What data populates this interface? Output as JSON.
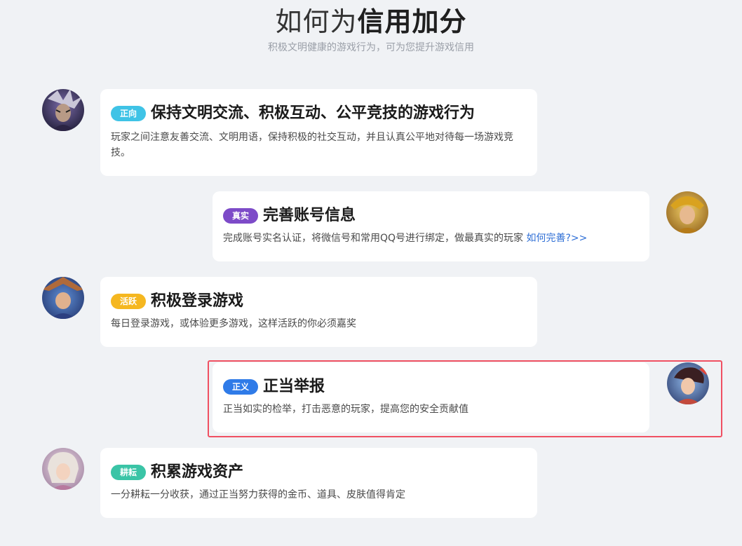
{
  "header": {
    "title_normal": "如何为",
    "title_bold": "信用加分",
    "subtitle": "积极文明健康的游戏行为，可为您提升游戏信用"
  },
  "items": [
    {
      "tag": "正向",
      "tag_color": "#3fc3e6",
      "title": "保持文明交流、积极互动、公平竞技的游戏行为",
      "desc": "玩家之间注意友善交流、文明用语，保持积极的社交互动，并且认真公平地对待每一场游戏竞技。",
      "avatar": "dark-knight-avatar-icon"
    },
    {
      "tag": "真实",
      "tag_color": "#7d4bc8",
      "title": "完善账号信息",
      "desc": "完成账号实名认证，将微信号和常用QQ号进行绑定，做最真实的玩家",
      "link": "如何完善?>>",
      "avatar": "golden-warrior-avatar-icon"
    },
    {
      "tag": "活跃",
      "tag_color": "#f5b720",
      "title": "积极登录游戏",
      "desc": "每日登录游戏，或体验更多游戏，这样活跃的你必须嘉奖",
      "avatar": "straw-hat-hero-avatar-icon"
    },
    {
      "tag": "正义",
      "tag_color": "#2f7be8",
      "title": "正当举报",
      "desc": "正当如实的检举，打击恶意的玩家，提高您的安全贡献值",
      "avatar": "red-plume-heroine-avatar-icon"
    },
    {
      "tag": "耕耘",
      "tag_color": "#3ac4a6",
      "title": "积累游戏资产",
      "desc": "一分耕耘一分收获，通过正当努力获得的金币、道具、皮肤值得肯定",
      "avatar": "silver-hair-heroine-avatar-icon"
    }
  ]
}
